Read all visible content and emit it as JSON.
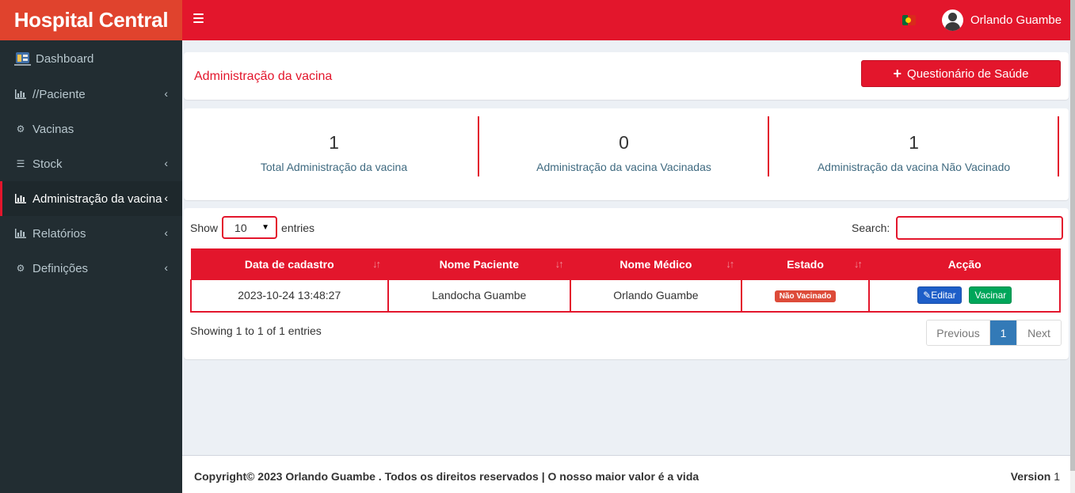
{
  "app": {
    "title": "Hospital Central"
  },
  "header": {
    "user_name": "Orlando Guambe",
    "flag": "portugal-flag"
  },
  "sidebar": {
    "items": [
      {
        "label": "Dashboard",
        "icon": "dashboard-icon"
      },
      {
        "label": "//Paciente",
        "icon": "bar-chart-icon"
      },
      {
        "label": "Vacinas",
        "icon": "cogs-icon"
      },
      {
        "label": "Stock",
        "icon": "list-icon"
      },
      {
        "label": "Administração da vacina",
        "icon": "bar-chart-icon"
      },
      {
        "label": "Relatórios",
        "icon": "bar-chart-icon"
      },
      {
        "label": "Definições",
        "icon": "cogs-icon"
      }
    ],
    "active": "Administração da vacina"
  },
  "page": {
    "title": "Administração da vacina",
    "add_button": "Questionário de Saúde"
  },
  "stats": [
    {
      "value": "1",
      "label": "Total Administração da vacina"
    },
    {
      "value": "0",
      "label": "Administração da vacina Vacinadas"
    },
    {
      "value": "1",
      "label": "Administração da vacina Não Vacinado"
    }
  ],
  "table": {
    "show_label": "Show",
    "entries_label": "entries",
    "page_length": "10",
    "search_label": "Search:",
    "search_value": "",
    "columns": [
      "Data de cadastro",
      "Nome Paciente",
      "Nome Médico",
      "Estado",
      "Acção"
    ],
    "rows": [
      {
        "date": "2023-10-24 13:48:27",
        "patient": "Landocha Guambe",
        "doctor": "Orlando Guambe",
        "status": "Não Vacinado",
        "edit": "Editar",
        "vaccinate": "Vacinar"
      }
    ],
    "info": "Showing 1 to 1 of 1 entries",
    "pagination": {
      "previous": "Previous",
      "current": "1",
      "next": "Next"
    }
  },
  "footer": {
    "copyright": "Copyright© 2023 Orlando Guambe . Todos os direitos reservados | O nosso maior valor é a vida",
    "version_label": "Version",
    "version_value": "1"
  },
  "colors": {
    "brand": "#e3162c",
    "logo_bg": "#e0432d",
    "sidebar": "#222d32",
    "status_badge": "#dd4b39",
    "edit": "#1e5ec8",
    "vaccinate": "#00a65a"
  }
}
